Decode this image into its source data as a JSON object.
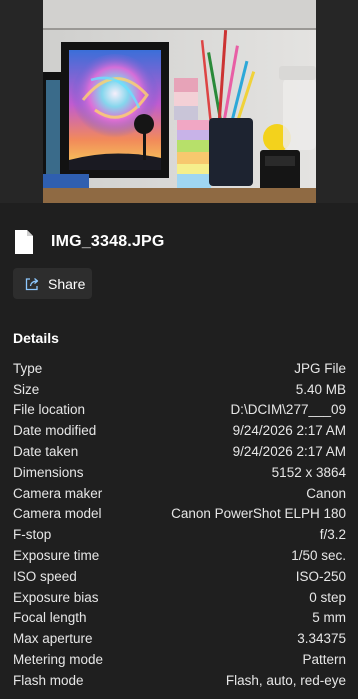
{
  "file": {
    "icon": "document-icon",
    "name": "IMG_3348.JPG"
  },
  "share": {
    "icon": "share-icon",
    "label": "Share"
  },
  "details": {
    "heading": "Details",
    "rows": [
      {
        "label": "Type",
        "value": "JPG File"
      },
      {
        "label": "Size",
        "value": "5.40 MB"
      },
      {
        "label": "File location",
        "value": "D:\\DCIM\\277___09"
      },
      {
        "label": "Date modified",
        "value": "9/24/2026 2:17 AM"
      },
      {
        "label": "Date taken",
        "value": "9/24/2026 2:17 AM"
      },
      {
        "label": "Dimensions",
        "value": "5152 x 3864"
      },
      {
        "label": "Camera maker",
        "value": "Canon"
      },
      {
        "label": "Camera model",
        "value": "Canon PowerShot ELPH 180"
      },
      {
        "label": "F-stop",
        "value": "f/3.2"
      },
      {
        "label": "Exposure time",
        "value": "1/50 sec."
      },
      {
        "label": "ISO speed",
        "value": "ISO-250"
      },
      {
        "label": "Exposure bias",
        "value": "0 step"
      },
      {
        "label": "Focal length",
        "value": "5 mm"
      },
      {
        "label": "Max aperture",
        "value": "3.34375"
      },
      {
        "label": "Metering mode",
        "value": "Pattern"
      },
      {
        "label": "Flash mode",
        "value": "Flash, auto, red-eye"
      }
    ]
  }
}
